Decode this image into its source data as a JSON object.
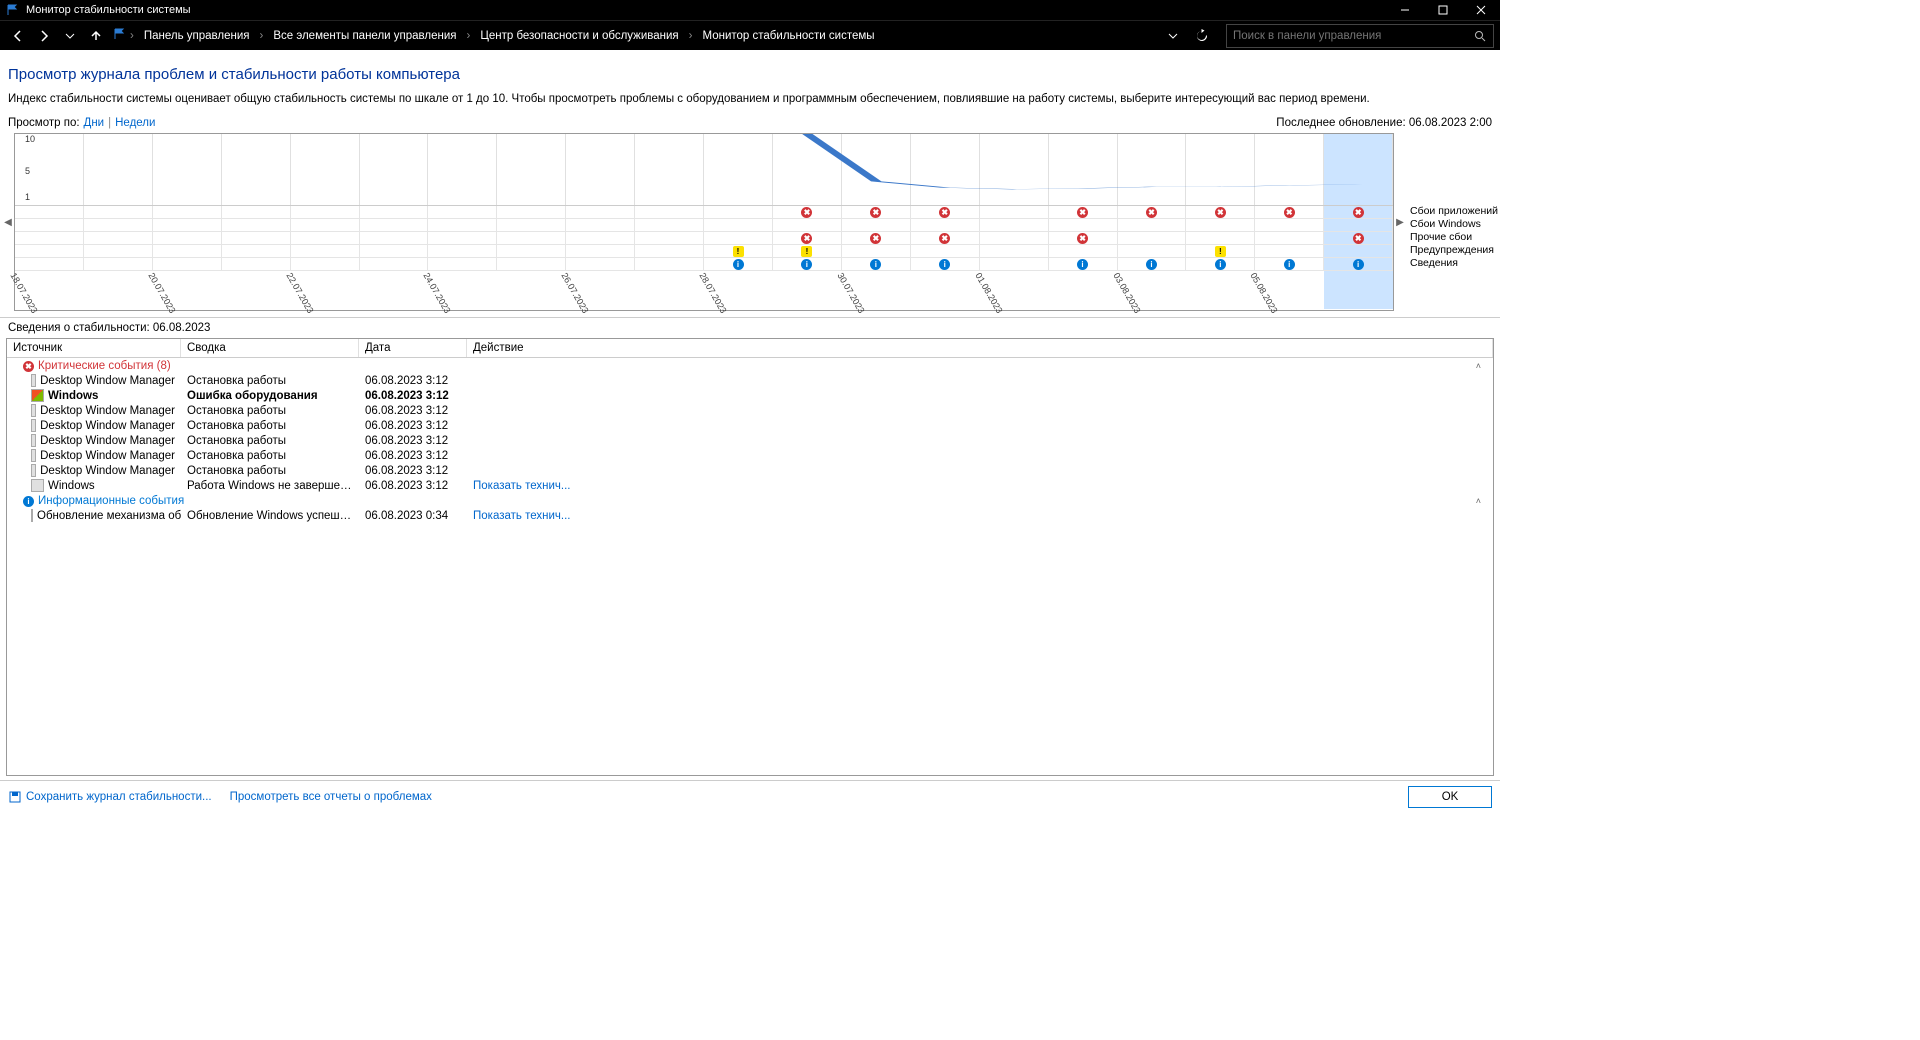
{
  "window": {
    "title": "Монитор стабильности системы"
  },
  "breadcrumbs": [
    "Панель управления",
    "Все элементы панели управления",
    "Центр безопасности и обслуживания",
    "Монитор стабильности системы"
  ],
  "search": {
    "placeholder": "Поиск в панели управления"
  },
  "page": {
    "heading": "Просмотр журнала проблем и стабильности работы компьютера",
    "description": "Индекс стабильности системы оценивает общую стабильность системы по шкале от 1 до 10. Чтобы просмотреть проблемы с оборудованием и программным обеспечением, повлиявшие на работу системы, выберите интересующий вас период времени."
  },
  "view": {
    "label": "Просмотр по:",
    "days": "Дни",
    "weeks": "Недели",
    "last_update_label": "Последнее обновление:",
    "last_update_value": "06.08.2023 2:00"
  },
  "chart_data": {
    "type": "line",
    "ylabel": "",
    "ylim": [
      1,
      10
    ],
    "yticks": [
      10,
      5,
      1
    ],
    "selected_index": 19,
    "categories": [
      "18.07.2023",
      "",
      "20.07.2023",
      "",
      "22.07.2023",
      "",
      "24.07.2023",
      "",
      "26.07.2023",
      "",
      "28.07.2023",
      "",
      "30.07.2023",
      "",
      "01.08.2023",
      "",
      "03.08.2023",
      "",
      "05.08.2023",
      ""
    ],
    "values": [
      null,
      null,
      null,
      null,
      null,
      null,
      null,
      null,
      null,
      null,
      10,
      10,
      4.0,
      3.2,
      3.0,
      3.1,
      3.3,
      3.3,
      3.5,
      3.6
    ],
    "event_rows": [
      {
        "label": "Сбои приложений",
        "kind": "err",
        "marks": [
          0,
          0,
          0,
          0,
          0,
          0,
          0,
          0,
          0,
          0,
          0,
          1,
          1,
          1,
          0,
          1,
          1,
          1,
          1,
          1
        ]
      },
      {
        "label": "Сбои Windows",
        "kind": "err",
        "marks": [
          0,
          0,
          0,
          0,
          0,
          0,
          0,
          0,
          0,
          0,
          0,
          0,
          0,
          0,
          0,
          0,
          0,
          0,
          0,
          0
        ]
      },
      {
        "label": "Прочие сбои",
        "kind": "err",
        "marks": [
          0,
          0,
          0,
          0,
          0,
          0,
          0,
          0,
          0,
          0,
          0,
          1,
          1,
          1,
          0,
          1,
          0,
          0,
          0,
          1
        ]
      },
      {
        "label": "Предупреждения",
        "kind": "warn",
        "marks": [
          0,
          0,
          0,
          0,
          0,
          0,
          0,
          0,
          0,
          0,
          1,
          1,
          0,
          0,
          0,
          0,
          0,
          1,
          0,
          0
        ]
      },
      {
        "label": "Сведения",
        "kind": "info",
        "marks": [
          0,
          0,
          0,
          0,
          0,
          0,
          0,
          0,
          0,
          0,
          1,
          1,
          1,
          1,
          0,
          1,
          1,
          1,
          1,
          1
        ]
      }
    ]
  },
  "details": {
    "heading": "Сведения о стабильности: 06.08.2023",
    "columns": {
      "source": "Источник",
      "summary": "Сводка",
      "date": "Дата",
      "action": "Действие"
    },
    "groups": [
      {
        "kind": "err",
        "title": "Критические события (8)",
        "rows": [
          {
            "icon": "app",
            "source": "Desktop Window Manager",
            "summary": "Остановка работы",
            "date": "06.08.2023 3:12",
            "action": ""
          },
          {
            "icon": "win",
            "bold": true,
            "source": "Windows",
            "summary": "Ошибка оборудования",
            "date": "06.08.2023 3:12",
            "action": ""
          },
          {
            "icon": "app",
            "source": "Desktop Window Manager",
            "summary": "Остановка работы",
            "date": "06.08.2023 3:12",
            "action": ""
          },
          {
            "icon": "app",
            "source": "Desktop Window Manager",
            "summary": "Остановка работы",
            "date": "06.08.2023 3:12",
            "action": ""
          },
          {
            "icon": "app",
            "source": "Desktop Window Manager",
            "summary": "Остановка работы",
            "date": "06.08.2023 3:12",
            "action": ""
          },
          {
            "icon": "app",
            "source": "Desktop Window Manager",
            "summary": "Остановка работы",
            "date": "06.08.2023 3:12",
            "action": ""
          },
          {
            "icon": "app",
            "source": "Desktop Window Manager",
            "summary": "Остановка работы",
            "date": "06.08.2023 3:12",
            "action": ""
          },
          {
            "icon": "app",
            "source": "Windows",
            "summary": "Работа Windows не завершена должн...",
            "date": "06.08.2023 3:12",
            "action": "Показать технич..."
          }
        ]
      },
      {
        "kind": "info",
        "title": "Информационные события",
        "rows": [
          {
            "icon": "app",
            "source": "Обновление механизма обнару...",
            "summary": "Обновление Windows успешно завер...",
            "date": "06.08.2023 0:34",
            "action": "Показать технич..."
          }
        ]
      }
    ]
  },
  "footer": {
    "save": "Сохранить журнал стабильности...",
    "view_all": "Просмотреть все отчеты о проблемах",
    "ok": "OK"
  }
}
